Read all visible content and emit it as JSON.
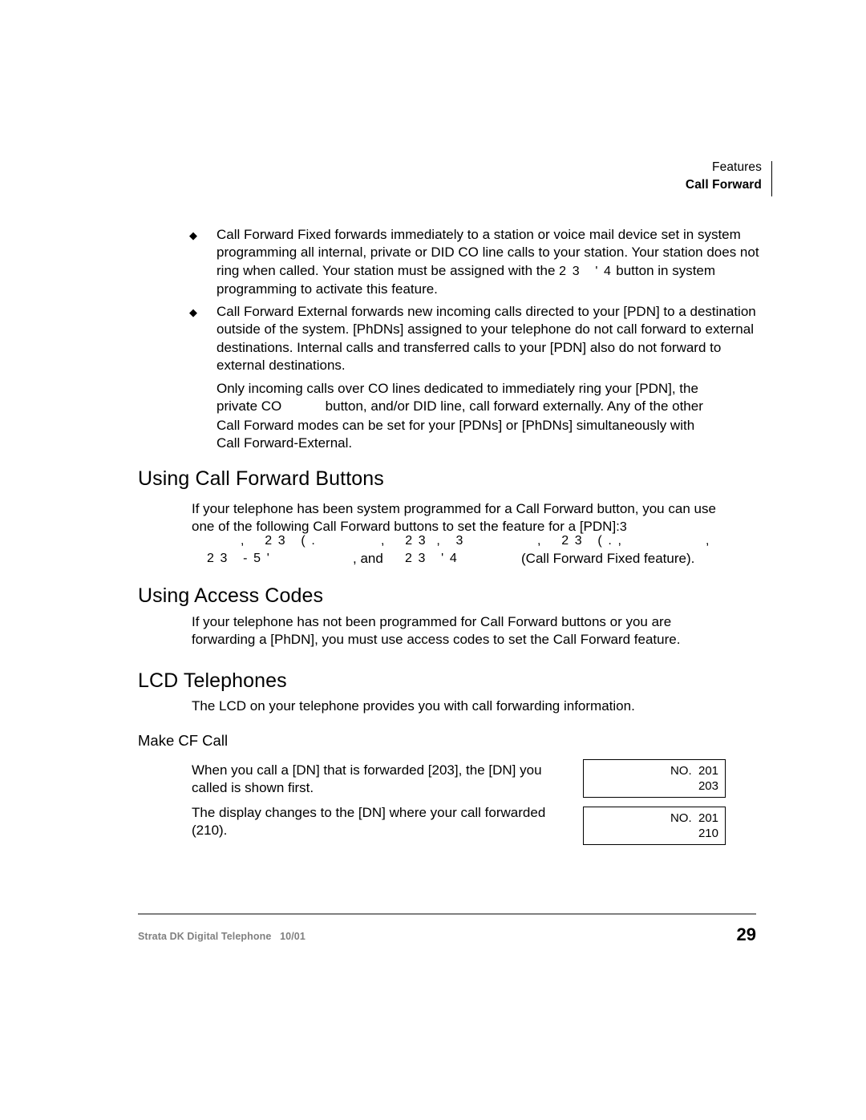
{
  "header": {
    "line1": "Features",
    "line2": "Call Forward"
  },
  "bullets": [
    {
      "marker": "◆",
      "text_before": "Call Forward    Fixed forwards immediately to a station or voice mail device set in system programming all internal, private or DID CO line calls to your station. Your station does not ring when called. Your station must be assigned with the ",
      "symbol_glyphs": "2 3   ' 4",
      "text_after": "          button in system programming to activate this feature."
    },
    {
      "marker": "◆",
      "text_before": "Call Forward    External forwards new incoming calls directed to your [PDN] to a destination outside of the system. [PhDNs] assigned to your telephone do not call forward to external destinations. Internal calls and transferred calls to your [PDN] also do not forward to external destinations.",
      "symbol_glyphs": "",
      "text_after": ""
    }
  ],
  "paragraph_external": {
    "line1": "Only incoming calls over CO lines dedicated to immediately ring your [PDN], the",
    "line2_a": "private CO",
    "line2_b": "button, and/or DID line, call forward externally. Any of the other",
    "line3": "Call Forward modes can be set for your [PDNs] or [PhDNs] simultaneously with",
    "line4": "Call Forward-External."
  },
  "sections": {
    "using_buttons": {
      "heading": "Using Call Forward Buttons",
      "para_line1": "If your telephone has been system programmed for a Call Forward button, you can use",
      "para_line2": "one of the following Call Forward buttons to set the feature for a [PDN]:",
      "trailing_glyph": "3",
      "glyph_line1_a": ",    2 3   ( .",
      "glyph_line1_b": ",    2 3  ,   3",
      "glyph_line1_c": ",    2 3   ( . ,",
      "glyph_line1_d": ",",
      "glyph_line2_a": "2 3   - 5 '",
      "glyph_line2_mid": ", and",
      "glyph_line2_b": "2 3   ' 4",
      "glyph_line2_tail": "(Call Forward Fixed feature)."
    },
    "using_access_codes": {
      "heading": "Using Access Codes",
      "para_line1": "If your telephone has not been programmed for Call Forward buttons or you are",
      "para_line2": "forwarding a [PhDN], you must use access codes to set the Call Forward feature."
    },
    "lcd_telephones": {
      "heading": "LCD Telephones",
      "para": "The LCD on your telephone provides you with call forwarding information.",
      "subheading": "Make CF Call",
      "para2_line1": "When you call a [DN] that is forwarded [203], the [DN] you",
      "para2_line2": "called is shown first.",
      "para3_line1": "The display changes to the [DN] where your call forwarded",
      "para3_line2": "(210)."
    }
  },
  "lcd_boxes": [
    {
      "line1": "NO.  201",
      "line2": "203"
    },
    {
      "line1": "NO.  201",
      "line2": "210"
    }
  ],
  "footer": {
    "left": "Strata DK Digital Telephone   10/01",
    "page_number": "29"
  }
}
